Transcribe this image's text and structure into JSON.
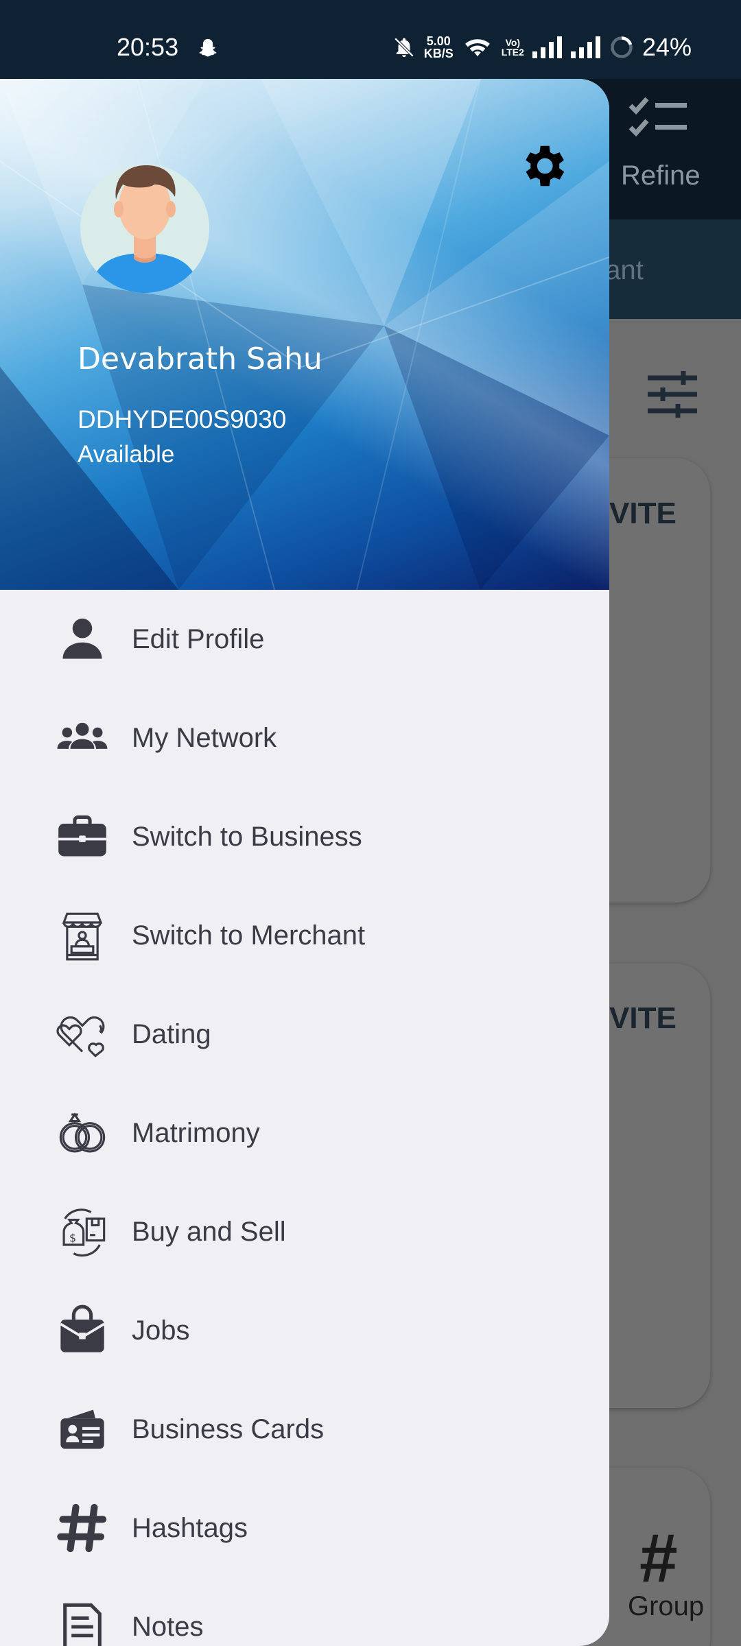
{
  "status_bar": {
    "time": "20:53",
    "speed_value": "5.00",
    "speed_unit": "KB/S",
    "volte_top": "Vo)",
    "volte_bottom": "LTE2",
    "battery": "24%"
  },
  "background_app": {
    "refine_label": "Refine",
    "tab_label_partial": "chant",
    "card_text": "VITE",
    "group_label": "Group"
  },
  "drawer": {
    "user": {
      "name": "Devabrath Sahu",
      "id": "DDHYDE00S9030",
      "status": "Available"
    },
    "menu": [
      {
        "label": "Edit Profile",
        "icon": "person-icon"
      },
      {
        "label": "My Network",
        "icon": "people-icon"
      },
      {
        "label": "Switch to Business",
        "icon": "briefcase-icon"
      },
      {
        "label": "Switch to Merchant",
        "icon": "merchant-stall-icon"
      },
      {
        "label": "Dating",
        "icon": "hearts-icon"
      },
      {
        "label": "Matrimony",
        "icon": "rings-icon"
      },
      {
        "label": "Buy and Sell",
        "icon": "buy-sell-icon"
      },
      {
        "label": "Jobs",
        "icon": "job-bag-icon"
      },
      {
        "label": "Business Cards",
        "icon": "business-card-icon"
      },
      {
        "label": "Hashtags",
        "icon": "hashtag-icon"
      },
      {
        "label": "Notes",
        "icon": "notes-icon"
      }
    ]
  },
  "colors": {
    "status_bar_bg": "#0e2234",
    "drawer_bg": "#f0eff4",
    "menu_text": "#3b3b45",
    "header_blue": "#1c7cc6"
  }
}
